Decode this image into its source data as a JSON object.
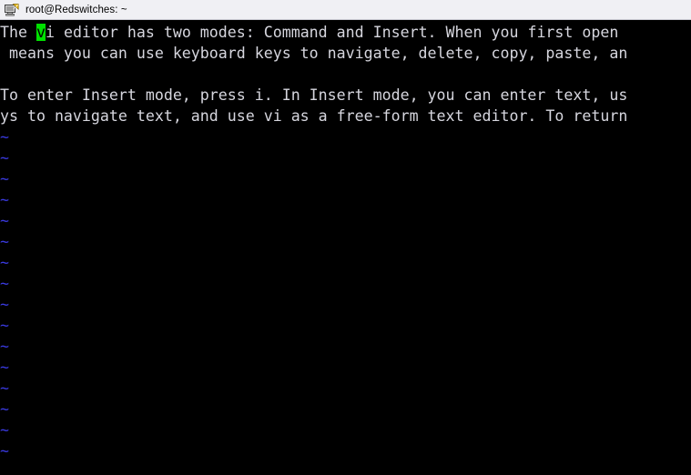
{
  "window": {
    "title": "root@Redswitches: ~",
    "icon": "putty-terminal-icon"
  },
  "terminal": {
    "colors": {
      "background": "#000000",
      "foreground": "#d6d6de",
      "cursor": "#00e000",
      "tilde": "#3a3ae0",
      "titlebar_background": "#f0f0f4"
    },
    "cursor": {
      "row": 0,
      "column": 4,
      "char": "v",
      "style": "block"
    },
    "lines": [
      {
        "type": "text",
        "segments": [
          {
            "text": "The "
          },
          {
            "text": "v",
            "style": "cursor"
          },
          {
            "text": "i editor has two modes: Command and Insert. When you first open "
          }
        ]
      },
      {
        "type": "text",
        "segments": [
          {
            "text": " means you can use keyboard keys to navigate, delete, copy, paste, an"
          }
        ]
      },
      {
        "type": "blank",
        "segments": [
          {
            "text": " "
          }
        ]
      },
      {
        "type": "text",
        "segments": [
          {
            "text": "To enter Insert mode, press i. In Insert mode, you can enter text, us"
          }
        ]
      },
      {
        "type": "text",
        "segments": [
          {
            "text": "ys to navigate text, and use vi as a free-form text editor. To return"
          }
        ]
      },
      {
        "type": "tilde",
        "segments": [
          {
            "text": "~",
            "style": "tilde"
          }
        ]
      },
      {
        "type": "tilde",
        "segments": [
          {
            "text": "~",
            "style": "tilde"
          }
        ]
      },
      {
        "type": "tilde",
        "segments": [
          {
            "text": "~",
            "style": "tilde"
          }
        ]
      },
      {
        "type": "tilde",
        "segments": [
          {
            "text": "~",
            "style": "tilde"
          }
        ]
      },
      {
        "type": "tilde",
        "segments": [
          {
            "text": "~",
            "style": "tilde"
          }
        ]
      },
      {
        "type": "tilde",
        "segments": [
          {
            "text": "~",
            "style": "tilde"
          }
        ]
      },
      {
        "type": "tilde",
        "segments": [
          {
            "text": "~",
            "style": "tilde"
          }
        ]
      },
      {
        "type": "tilde",
        "segments": [
          {
            "text": "~",
            "style": "tilde"
          }
        ]
      },
      {
        "type": "tilde",
        "segments": [
          {
            "text": "~",
            "style": "tilde"
          }
        ]
      },
      {
        "type": "tilde",
        "segments": [
          {
            "text": "~",
            "style": "tilde"
          }
        ]
      },
      {
        "type": "tilde",
        "segments": [
          {
            "text": "~",
            "style": "tilde"
          }
        ]
      },
      {
        "type": "tilde",
        "segments": [
          {
            "text": "~",
            "style": "tilde"
          }
        ]
      },
      {
        "type": "tilde",
        "segments": [
          {
            "text": "~",
            "style": "tilde"
          }
        ]
      },
      {
        "type": "tilde",
        "segments": [
          {
            "text": "~",
            "style": "tilde"
          }
        ]
      },
      {
        "type": "tilde",
        "segments": [
          {
            "text": "~",
            "style": "tilde"
          }
        ]
      },
      {
        "type": "tilde",
        "segments": [
          {
            "text": "~",
            "style": "tilde"
          }
        ]
      }
    ]
  }
}
